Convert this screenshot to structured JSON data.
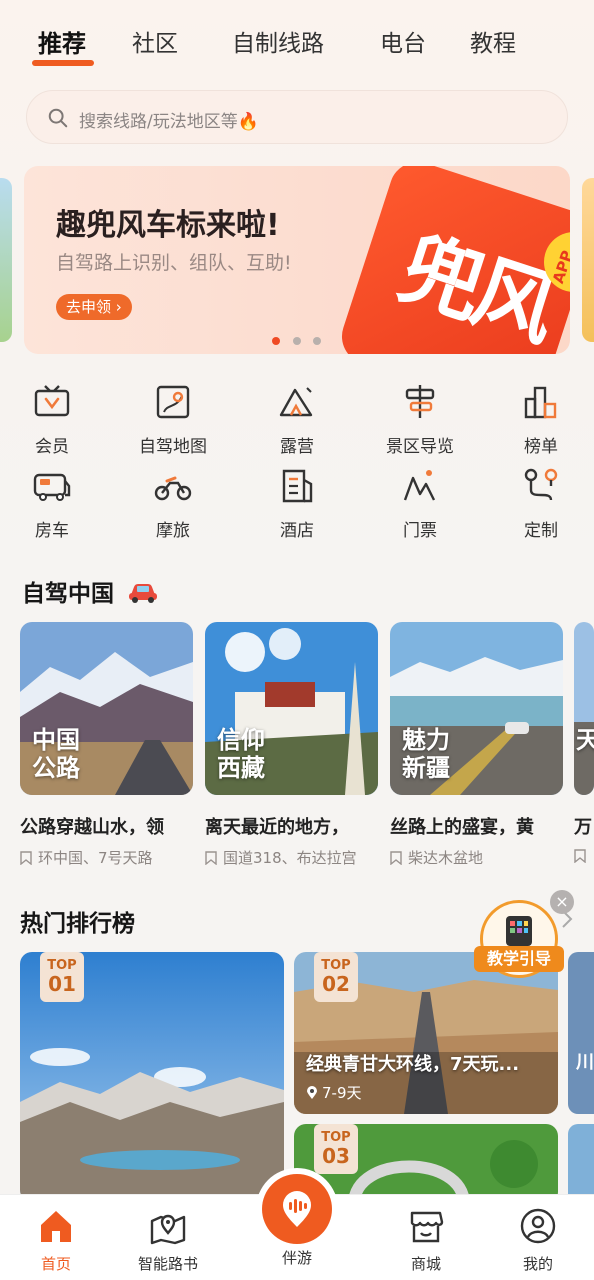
{
  "top_tabs": [
    {
      "label": "推荐",
      "active": true
    },
    {
      "label": "社区"
    },
    {
      "label": "自制线路"
    },
    {
      "label": "电台"
    },
    {
      "label": "教程"
    }
  ],
  "search": {
    "placeholder": "搜索线路/玩法地区等🔥"
  },
  "banner": {
    "title": "趣兜风车标来啦!",
    "subtitle": "自驾路上识别、组队、互助!",
    "button": "去申领 ›",
    "logo_text": "兜风",
    "app_tag": "APP",
    "page_count": 3,
    "active_page": 1
  },
  "quick_links": [
    {
      "label": "会员",
      "icon": "tv-icon"
    },
    {
      "label": "自驾地图",
      "icon": "map-icon"
    },
    {
      "label": "露营",
      "icon": "tent-icon"
    },
    {
      "label": "景区导览",
      "icon": "signpost-icon"
    },
    {
      "label": "榜单",
      "icon": "bar-chart-icon"
    },
    {
      "label": "房车",
      "icon": "rv-icon"
    },
    {
      "label": "摩旅",
      "icon": "motorcycle-icon"
    },
    {
      "label": "酒店",
      "icon": "hotel-icon"
    },
    {
      "label": "门票",
      "icon": "ticket-icon"
    },
    {
      "label": "定制",
      "icon": "route-icon"
    }
  ],
  "self_drive": {
    "title": "自驾中国",
    "cards": [
      {
        "image_title": "中国公路",
        "title": "公路穿越山水，领",
        "tag": "环中国、7号天路"
      },
      {
        "image_title": "信仰西藏",
        "title": "离天最近的地方，",
        "tag": "国道318、布达拉宫"
      },
      {
        "image_title": "魅力新疆",
        "title": "丝路上的盛宴，黄",
        "tag": "柴达木盆地"
      },
      {
        "image_title": "天",
        "title": "万",
        "tag": ""
      }
    ]
  },
  "ranking": {
    "title": "热门排行榜",
    "items": [
      {
        "badge_top": "TOP",
        "badge_num": "01",
        "title": "",
        "days": ""
      },
      {
        "badge_top": "TOP",
        "badge_num": "02",
        "title": "经典青甘大环线，7天玩...",
        "days": "7-9天"
      },
      {
        "badge_top": "TOP",
        "badge_num": "03",
        "title": "",
        "days": ""
      },
      {
        "peek_text": "川"
      }
    ]
  },
  "guide": {
    "label": "教学引导",
    "close": "×"
  },
  "bottom_nav": [
    {
      "label": "首页",
      "icon": "home-icon",
      "active": true
    },
    {
      "label": "智能路书",
      "icon": "map-pin-book-icon"
    },
    {
      "label": "伴游",
      "icon": "audio-wave-icon"
    },
    {
      "label": "商城",
      "icon": "store-icon"
    },
    {
      "label": "我的",
      "icon": "profile-icon"
    }
  ],
  "colors": {
    "accent": "#ef5b20",
    "icon_accent": "#f07a3a"
  }
}
